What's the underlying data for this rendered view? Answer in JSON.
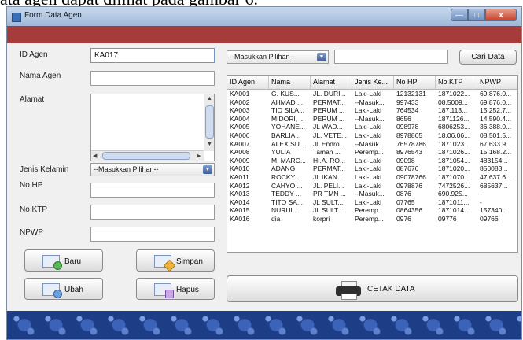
{
  "caption": "ata agen dapat dilihat pada gambar 6.",
  "window": {
    "title": "Form Data Agen",
    "close_glyph": "x"
  },
  "form": {
    "id_label": "ID Agen",
    "id_value": "KA017",
    "nama_label": "Nama Agen",
    "alamat_label": "Alamat",
    "jk_label": "Jenis Kelamin",
    "jk_value": "--Masukkan Pilihan--",
    "nohp_label": "No HP",
    "noktp_label": "No KTP",
    "npwp_label": "NPWP"
  },
  "buttons": {
    "baru": "Baru",
    "simpan": "Simpan",
    "ubah": "Ubah",
    "hapus": "Hapus",
    "cari": "Cari Data",
    "cetak": "CETAK DATA"
  },
  "search": {
    "combo_value": "--Masukkan Pilihan--",
    "query": ""
  },
  "table": {
    "columns": [
      "ID Agen",
      "Nama",
      "Alamat",
      "Jenis Ke...",
      "No HP",
      "No KTP",
      "NPWP"
    ],
    "rows": [
      [
        "KA001",
        "G. KUS...",
        "JL. DURI...",
        "Laki-Laki",
        "12132131",
        "1871022...",
        "69.876.0..."
      ],
      [
        "KA002",
        "AHMAD ...",
        "PERMAT...",
        "--Masuk...",
        "997433",
        "08.5009...",
        "69.876.0..."
      ],
      [
        "KA003",
        "TIO SILA...",
        "PERUM ...",
        "Laki-Laki",
        "764534",
        "187.113...",
        "15.252.7..."
      ],
      [
        "KA004",
        "MIDORI, ...",
        "PERUM ...",
        "--Masuk...",
        "8656",
        "1871126...",
        "14.590.4..."
      ],
      [
        "KA005",
        "YOHANE...",
        "JL WAD...",
        "Laki-Laki",
        "098978",
        "6806253...",
        "36.388.0..."
      ],
      [
        "KA006",
        "BARLIA...",
        "JL. VETE...",
        "Laki-Laki",
        "8978865",
        "18.06.06...",
        "08.501.5..."
      ],
      [
        "KA007",
        "ALEX SU...",
        "Jl. Endro...",
        "--Masuk...",
        "76578786",
        "1871023...",
        "67.633.9..."
      ],
      [
        "KA008",
        "YULIA",
        "Taman ...",
        "Peremp...",
        "8976543",
        "1871026...",
        "15.168.2..."
      ],
      [
        "KA009",
        "M. MARC...",
        "HI.A. RO...",
        "Laki-Laki",
        "09098",
        "1871054...",
        "483154..."
      ],
      [
        "KA010",
        "ADANG",
        "PERMAT...",
        "Laki-Laki",
        "087676",
        "1871020...",
        "850083..."
      ],
      [
        "KA011",
        "ROCKY ...",
        "JL IKAN ...",
        "Laki-Laki",
        "09078766",
        "1871070...",
        "47.637.6..."
      ],
      [
        "KA012",
        "CAHYO ...",
        "JL. PELI...",
        "Laki-Laki",
        "0978876",
        "7472526...",
        "685637..."
      ],
      [
        "KA013",
        "TEDDY ...",
        "PR TMN ...",
        "--Masuk...",
        "0876",
        "690.925...",
        "-"
      ],
      [
        "KA014",
        "TITO SA...",
        "JL SULT...",
        "Laki-Laki",
        "07765",
        "1871011...",
        "-"
      ],
      [
        "KA015",
        "NURUL ...",
        "JL SULT...",
        "Peremp...",
        "0864356",
        "1871014...",
        "157340..."
      ],
      [
        "KA016",
        "dia",
        "korpri",
        "Peremp...",
        "0976",
        "09776",
        "09766"
      ]
    ]
  }
}
